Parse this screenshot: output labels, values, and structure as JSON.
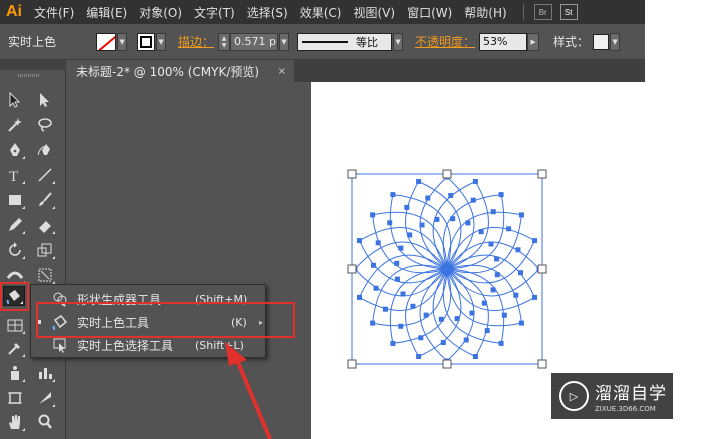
{
  "menubar": {
    "logo": "Ai",
    "items": [
      "文件(F)",
      "编辑(E)",
      "对象(O)",
      "文字(T)",
      "选择(S)",
      "效果(C)",
      "视图(V)",
      "窗口(W)",
      "帮助(H)"
    ],
    "br_label": "Br",
    "st_label": "St"
  },
  "controlbar": {
    "tool_label": "实时上色",
    "stroke_label": "描边：",
    "stroke_value": "0.571",
    "stroke_unit": "p",
    "line_label": "等比",
    "opacity_label": "不透明度：",
    "opacity_value": "53%",
    "style_label": "样式："
  },
  "document": {
    "tab_title": "未标题-2* @ 100% (CMYK/预览)",
    "tab_close": "×"
  },
  "flyout": {
    "items": [
      {
        "name": "形状生成器工具",
        "shortcut": "(Shift+M)"
      },
      {
        "name": "实时上色工具",
        "shortcut": "(K)"
      },
      {
        "name": "实时上色选择工具",
        "shortcut": "(Shift+L)"
      }
    ],
    "submenu_glyph": "▸"
  },
  "watermark": {
    "title": "溜溜自学",
    "subtitle": "ZIXUE.3D66.COM"
  },
  "colors": {
    "accent_orange": "#f29b1f",
    "highlight_red": "#e0312d",
    "artwork_blue": "#3b73e0"
  }
}
